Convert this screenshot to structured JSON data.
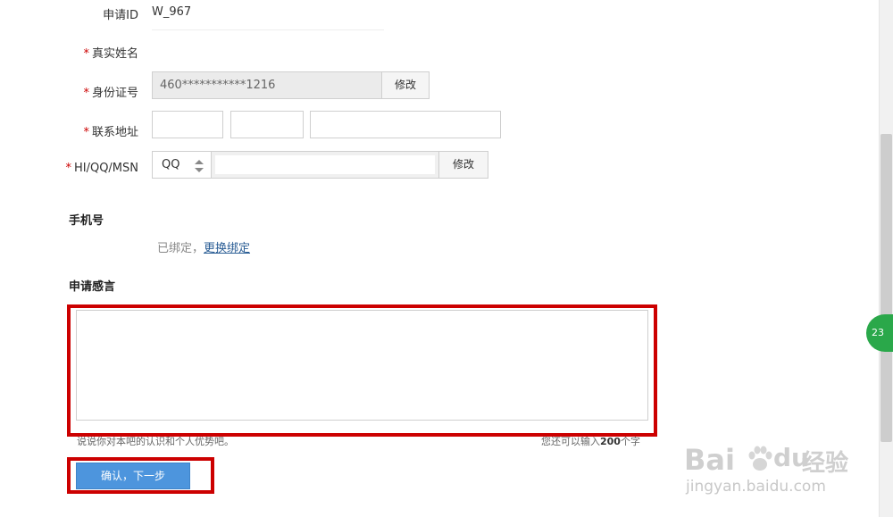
{
  "form": {
    "apply_id_label": "申请ID",
    "apply_id_value": "W_967",
    "required_mark": "*",
    "real_name_label": "真实姓名",
    "id_card_label": "身份证号",
    "id_card_value": "460***********1216",
    "id_edit_button": "修改",
    "address_label": "联系地址",
    "im_label": "HI/QQ/MSN",
    "im_type_selected": "QQ",
    "im_edit_button": "修改",
    "phone_section_title": "手机号",
    "phone_bound_text": "已绑定，",
    "phone_change_link": "更换绑定",
    "statement_section_title": "申请感言",
    "statement_hint": "说说你对本吧的认识和个人优势吧。",
    "statement_counter_prefix": "您还可以输入",
    "statement_counter_value": "200",
    "statement_counter_suffix": "个字",
    "submit_button": "确认，下一步"
  },
  "floating_badge": "23",
  "watermark": {
    "logo_text": "Bai",
    "logo_text2": "du",
    "logo_cn": "经验",
    "url": "jingyan.baidu.com"
  },
  "colors": {
    "annotation_red": "#cc0000",
    "primary_blue": "#4d95dd",
    "link_blue": "#2a5d95"
  }
}
